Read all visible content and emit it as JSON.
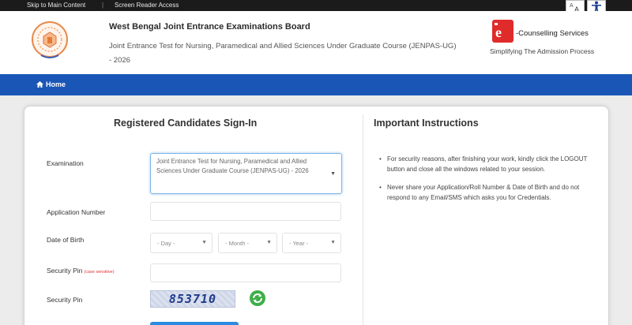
{
  "topbar": {
    "skip_link": "Skip to Main Content",
    "separator": "|",
    "reader_link": "Screen Reader Access"
  },
  "header": {
    "title": "West Bengal Joint Entrance Examinations Board",
    "subtitle": "Joint Entrance Test for Nursing, Paramedical and Allied Sciences Under Graduate Course (JENPAS-UG) - 2026",
    "brand_text": "-Counselling Services",
    "brand_tagline": "Simplifying The Admission Process"
  },
  "nav": {
    "home_label": "Home"
  },
  "form": {
    "title": "Registered Candidates Sign-In",
    "examination_label": "Examination",
    "examination_value": "Joint Entrance Test for Nursing, Paramedical and Allied Sciences Under Graduate Course (JENPAS-UG) - 2026",
    "application_label": "Application Number",
    "dob_label": "Date of Birth",
    "day_placeholder": "- Day -",
    "month_placeholder": "- Month -",
    "year_placeholder": "- Year -",
    "pin_label": "Security Pin",
    "pin_note": "(case sensitive)",
    "captcha_label": "Security Pin",
    "captcha_value": "853710"
  },
  "instructions": {
    "title": "Important Instructions",
    "items": [
      "For security reasons, after finishing your work, kindly click the LOGOUT button and close all the windows related to your session.",
      "Never share your Application/Roll Number & Date of Birth and do not respond to any Email/SMS which asks you for Credentials."
    ]
  },
  "colors": {
    "nav_blue": "#1a56b6",
    "accent_red": "#e02b2b",
    "button_blue": "#2a8be0"
  }
}
